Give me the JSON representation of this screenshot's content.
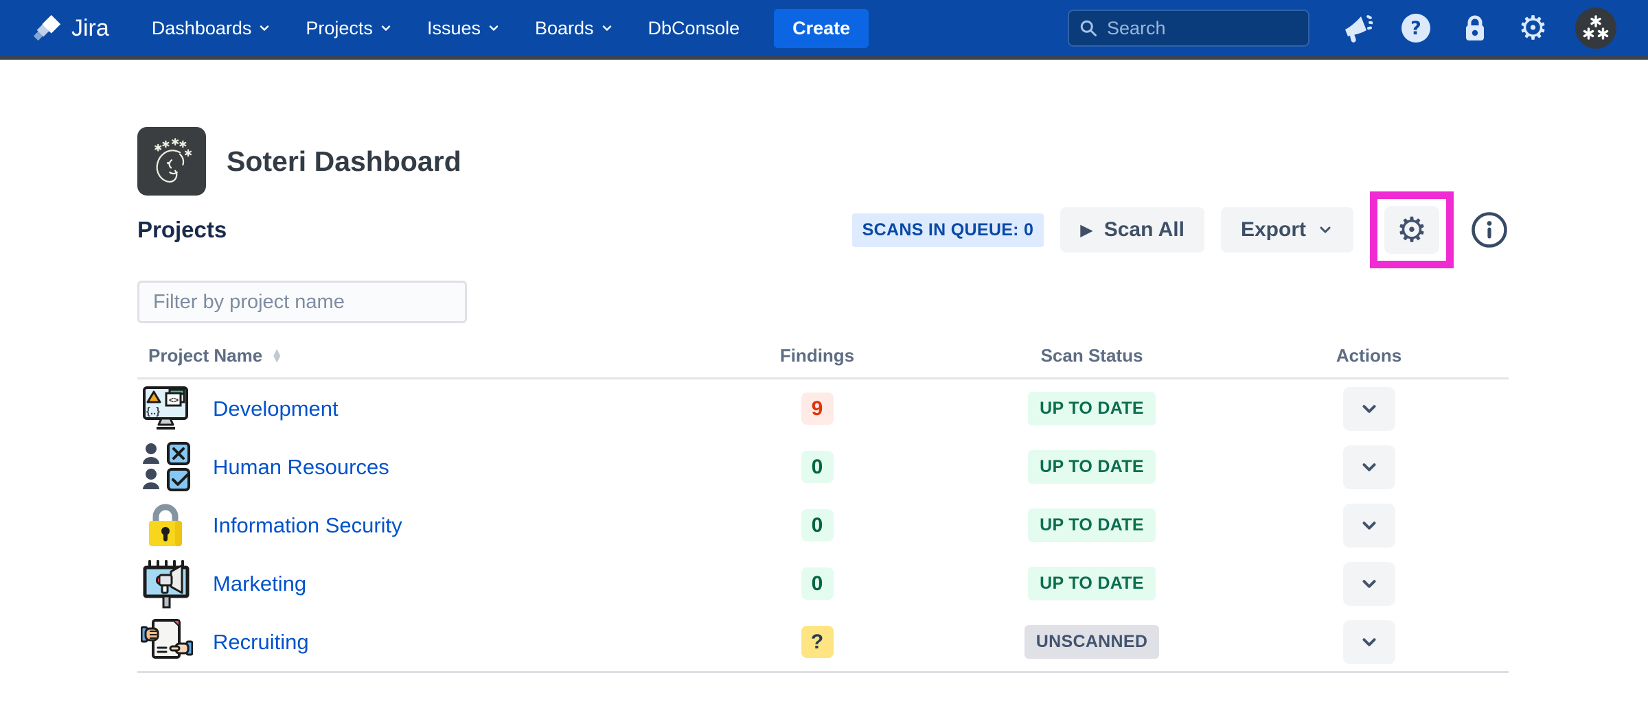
{
  "nav": {
    "brand": "Jira",
    "items": [
      "Dashboards",
      "Projects",
      "Issues",
      "Boards",
      "DbConsole"
    ],
    "create_label": "Create",
    "search_placeholder": "Search",
    "icon_names": [
      "announcement-icon",
      "help-icon",
      "lock-icon",
      "gear-icon",
      "user-avatar"
    ]
  },
  "header": {
    "title": "Soteri Dashboard",
    "app_icon": "soteri-logo-icon"
  },
  "section": {
    "heading": "Projects",
    "queue_badge": "SCANS IN QUEUE: 0",
    "scan_all_label": "Scan All",
    "export_label": "Export",
    "filter_placeholder": "Filter by project name"
  },
  "table": {
    "columns": [
      "Project Name",
      "Findings",
      "Scan Status",
      "Actions"
    ],
    "rows": [
      {
        "name": "Development",
        "icon": "development-icon",
        "findings": "9",
        "findings_style": "danger",
        "status": "UP TO DATE",
        "status_style": "success"
      },
      {
        "name": "Human Resources",
        "icon": "human-resources-icon",
        "findings": "0",
        "findings_style": "success",
        "status": "UP TO DATE",
        "status_style": "success"
      },
      {
        "name": "Information Security",
        "icon": "information-security-icon",
        "findings": "0",
        "findings_style": "success",
        "status": "UP TO DATE",
        "status_style": "success"
      },
      {
        "name": "Marketing",
        "icon": "marketing-icon",
        "findings": "0",
        "findings_style": "success",
        "status": "UP TO DATE",
        "status_style": "success"
      },
      {
        "name": "Recruiting",
        "icon": "recruiting-icon",
        "findings": "?",
        "findings_style": "warning",
        "status": "UNSCANNED",
        "status_style": "neutral"
      }
    ]
  },
  "colors": {
    "nav_blue": "#0A4AA6",
    "create_blue": "#0C66E4",
    "link_blue": "#0052CC",
    "highlight_magenta": "#F12BD4",
    "success_bg": "#E3FCEF",
    "success_text": "#006644",
    "danger_bg": "#FFEBE6",
    "danger_text": "#DE350B",
    "warning_bg": "#FFE483",
    "neutral_bg": "#DFE1E6",
    "neutral_text": "#44546F",
    "queue_badge_bg": "#DEEBFF",
    "queue_badge_text": "#0849A5"
  }
}
